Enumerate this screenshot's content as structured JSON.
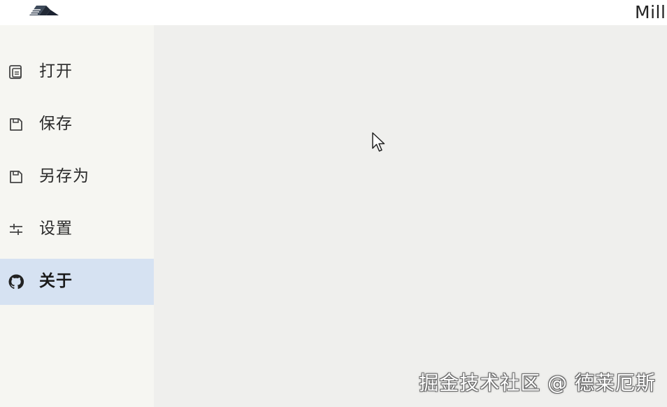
{
  "window": {
    "title": "Mill",
    "logo_icon": "book-logo-icon"
  },
  "sidebar": {
    "items": [
      {
        "label": "打开",
        "icon": "open-file-icon",
        "active": false
      },
      {
        "label": "保存",
        "icon": "save-icon",
        "active": false
      },
      {
        "label": "另存为",
        "icon": "save-as-icon",
        "active": false
      },
      {
        "label": "设置",
        "icon": "settings-sliders-icon",
        "active": false
      },
      {
        "label": "关于",
        "icon": "github-icon",
        "active": true
      }
    ]
  },
  "watermark": {
    "text": "掘金技术社区 @ 德莱厄斯"
  },
  "colors": {
    "active_item_bg": "#d6e2f2",
    "sidebar_bg": "#f6f6f2",
    "content_bg": "#efefed",
    "titlebar_bg": "#ffffff"
  }
}
